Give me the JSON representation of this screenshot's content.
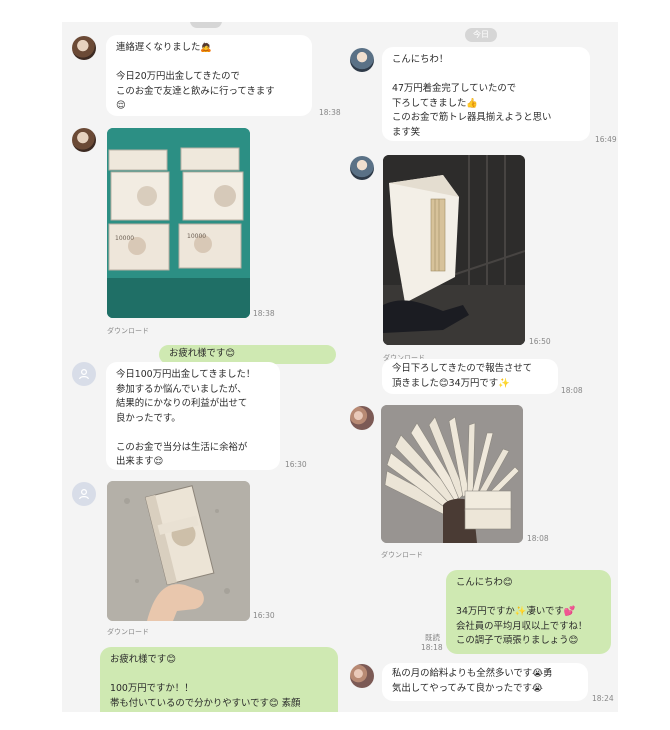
{
  "left": {
    "messages": [
      {
        "text": "連絡遅くなりました🙇\n\n今日20万円出金してきたので\nこのお金で友達と飲みに行ってきます\n😌",
        "time": "18:38"
      },
      {
        "time": "18:38",
        "caption": "ダウンロード"
      },
      {
        "text": "お疲れ様です😊"
      },
      {
        "text": "今日100万円出金してきました！\n参加するか悩んでいましたが、\n結果的にかなりの利益が出せて\n良かったです。\n\nこのお金で当分は生活に余裕が\n出来ます😌",
        "time": "16:30"
      },
      {
        "time": "16:30",
        "caption": "ダウンロード"
      },
      {
        "text": "お疲れ様です😊\n\n100万円ですか！！\n帯も付いているので分かりやすいです😊 素顔"
      }
    ]
  },
  "right": {
    "date_chip": "今日",
    "messages": [
      {
        "text": "こんにちわ！\n\n47万円着金完了していたので\n下ろしてきました👍\nこのお金で筋トレ器具揃えようと思い\nます笑",
        "time": "16:49"
      },
      {
        "time": "16:50",
        "caption": "ダウンロード"
      },
      {
        "text": "今日下ろしてきたので報告させて\n頂きました😊34万円です✨",
        "time": "18:08"
      },
      {
        "time": "18:08",
        "caption": "ダウンロード"
      },
      {
        "text": "こんにちわ😊\n\n34万円ですか✨凄いです💕\n会社員の平均月収以上ですね！\nこの調子で頑張りましょう😊",
        "read": "既読",
        "time": "18:18"
      },
      {
        "text": "私の月の給料よりも全然多いです😭勇\n気出してやってみて良かったです😭",
        "time": "18:24"
      }
    ]
  }
}
